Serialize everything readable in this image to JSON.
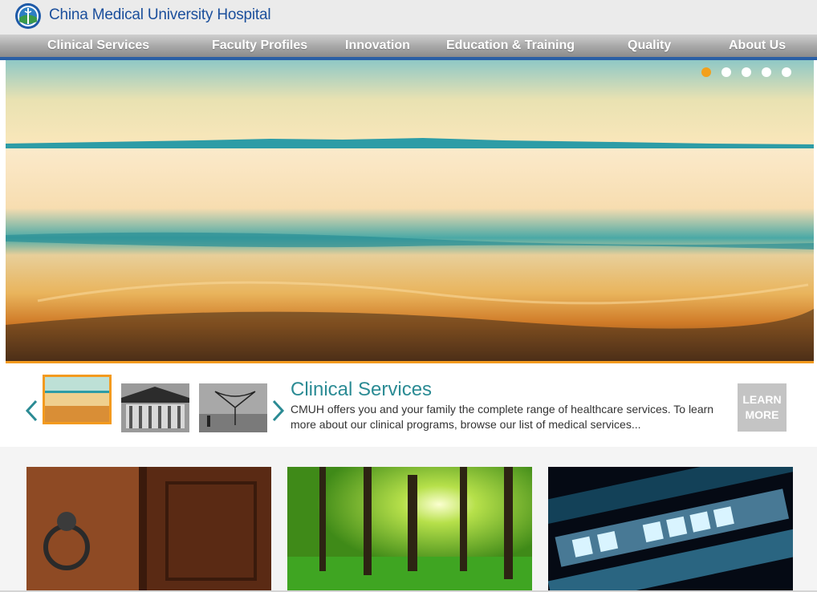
{
  "header": {
    "site_title": "China Medical University Hospital",
    "logo_icon": "cmuh-seal-icon"
  },
  "nav": {
    "items": [
      {
        "label": "Clinical Services"
      },
      {
        "label": "Faculty Profiles"
      },
      {
        "label": "Innovation"
      },
      {
        "label": "Education & Training"
      },
      {
        "label": "Quality"
      },
      {
        "label": "About Us"
      }
    ]
  },
  "hero": {
    "image": "seascape-at-sunset",
    "slide_count": 5,
    "active_slide": 1
  },
  "feature": {
    "prev_icon": "chevron-left-icon",
    "next_icon": "chevron-right-icon",
    "thumbnails": [
      {
        "image": "seascape-at-sunset",
        "selected": true
      },
      {
        "image": "temple-facade-bw",
        "selected": false
      },
      {
        "image": "fishing-net-bw",
        "selected": false
      }
    ],
    "title": "Clinical Services",
    "description": "CMUH offers you and your family the complete range of healthcare services. To learn more about our clinical programs, browse our list of medical services...",
    "learn_more_line1": "LEARN",
    "learn_more_line2": "MORE"
  },
  "tiles": [
    {
      "image": "old-wooden-door-knocker"
    },
    {
      "image": "sunlit-green-forest"
    },
    {
      "image": "on-time-boarding-display"
    }
  ],
  "colors": {
    "brand_blue": "#1b4f9c",
    "accent_orange": "#f39a1e",
    "teal": "#2b8b94"
  }
}
